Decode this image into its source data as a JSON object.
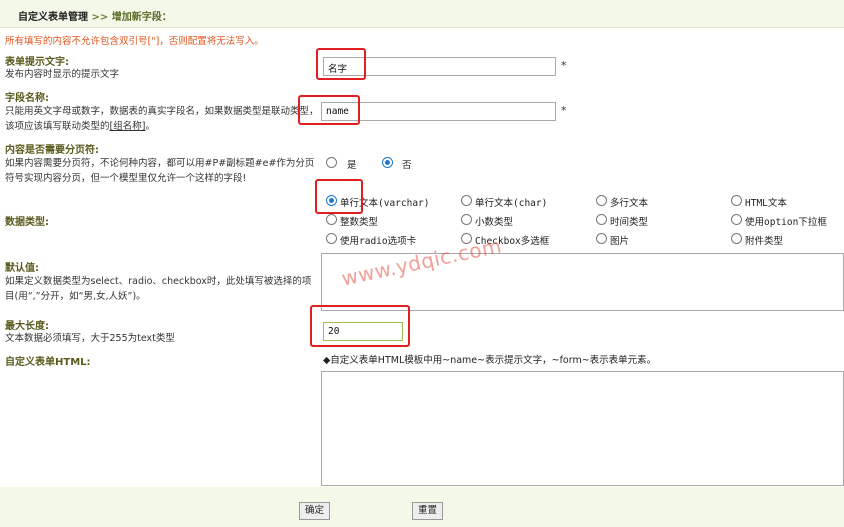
{
  "breadcrumb": {
    "root": "自定义表单管理",
    "separator": ">>",
    "current": "增加新字段："
  },
  "notice": "所有填写的内容不允许包含双引号[\"]，否则配置将无法写入。",
  "fields": {
    "prompt": {
      "label": "表单提示文字:",
      "help": "发布内容时显示的提示文字",
      "value": "名字",
      "required": "*"
    },
    "name": {
      "label": "字段名称:",
      "help_pre": "只能用英文字母或数字，数据表的真实字段名，如果数据类型是联动类型，该项应该填写联动类型的",
      "help_link": "[组名称]",
      "help_post": "。",
      "value": "name",
      "required": "*"
    },
    "paging": {
      "label": "内容是否需要分页符:",
      "help": "如果内容需要分页符，不论何种内容，都可以用#P#副标题#e#作为分页符号实现内容分页，但一个模型里仅允许一个这样的字段!",
      "options": [
        "是",
        "否"
      ],
      "selected": "否"
    },
    "datatype": {
      "label": "数据类型:",
      "options": [
        "单行文本(varchar)",
        "单行文本(char)",
        "多行文本",
        "HTML文本",
        "整数类型",
        "小数类型",
        "时间类型",
        "使用option下拉框",
        "使用radio选项卡",
        "Checkbox多选框",
        "图片",
        "附件类型"
      ],
      "selected": "单行文本(varchar)"
    },
    "default": {
      "label": "默认值:",
      "help": "如果定义数据类型为select、radio、checkbox时，此处填写被选择的项目(用“,”分开，如“男,女,人妖”)。"
    },
    "maxlen": {
      "label": "最大长度:",
      "help": "文本数据必须填写，大于255为text类型",
      "value": "20"
    },
    "html": {
      "label": "自定义表单HTML:",
      "tip": "◆自定义表单HTML模板中用~name~表示提示文字，~form~表示表单元素。"
    }
  },
  "watermark": "www.ydqic.com",
  "buttons": {
    "submit": "确定",
    "reset": "重置"
  },
  "colors": {
    "highlight": "#e02020",
    "accent": "#5b5b1e",
    "notice": "#e0541b",
    "header_bg": "#f3f8e9"
  }
}
